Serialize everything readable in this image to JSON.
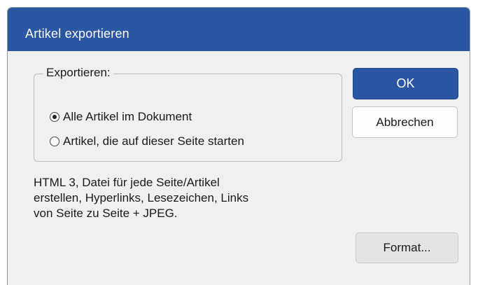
{
  "dialog": {
    "title": "Artikel exportieren"
  },
  "export_group": {
    "legend": "Exportieren:",
    "options": [
      {
        "label": "Alle Artikel im Dokument",
        "checked": true
      },
      {
        "label": "Artikel, die auf dieser Seite starten",
        "checked": false
      }
    ]
  },
  "buttons": {
    "ok": "OK",
    "cancel": "Abbrechen",
    "format": "Format..."
  },
  "description": "HTML 3, Datei für jede Seite/Artikel\nerstellen, Hyperlinks, Lesezeichen, Links\nvon Seite zu Seite + JPEG."
}
